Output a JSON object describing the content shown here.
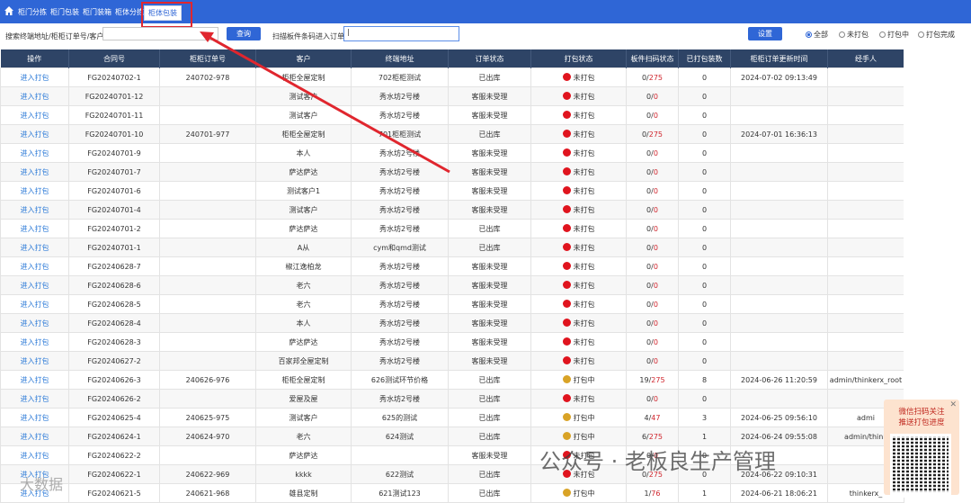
{
  "nav": {
    "tabs": [
      "柜门分拣",
      "柜门包装",
      "柜门装箱",
      "柜体分拣",
      "柜体包装"
    ],
    "active_index": 4
  },
  "search": {
    "label": "搜索终端地址/柜柜订单号/客户",
    "value": "",
    "button": "查询",
    "scan_label": "扫描板件条码进入订单",
    "scan_value": "|",
    "settings_button": "设置"
  },
  "filters": [
    {
      "label": "全部",
      "checked": true
    },
    {
      "label": "未打包",
      "checked": false
    },
    {
      "label": "打包中",
      "checked": false
    },
    {
      "label": "打包完成",
      "checked": false
    }
  ],
  "table": {
    "headers": [
      "操作",
      "合同号",
      "柜柜订单号",
      "客户",
      "终端地址",
      "订单状态",
      "打包状态",
      "板件扫码状态",
      "已打包装数",
      "柜柜订单更新时间",
      "经手人"
    ],
    "action_label": "进入打包",
    "rows": [
      {
        "contract": "FG20240702-1",
        "order_no": "240702-978",
        "customer": "柜柜全屋定制",
        "address": "702柜柜测试",
        "order_status": "已出库",
        "pack_status": "未打包",
        "pack_color": "red",
        "scanned": "0",
        "total": "275",
        "packed": "0",
        "updated": "2024-07-02 09:13:49",
        "handler": ""
      },
      {
        "contract": "FG20240701-12",
        "order_no": "",
        "customer": "测试客户",
        "address": "秀水坊2号楼",
        "order_status": "客服未受理",
        "pack_status": "未打包",
        "pack_color": "red",
        "scanned": "0",
        "total": "0",
        "packed": "0",
        "updated": "",
        "handler": ""
      },
      {
        "contract": "FG20240701-11",
        "order_no": "",
        "customer": "测试客户",
        "address": "秀水坊2号楼",
        "order_status": "客服未受理",
        "pack_status": "未打包",
        "pack_color": "red",
        "scanned": "0",
        "total": "0",
        "packed": "0",
        "updated": "",
        "handler": ""
      },
      {
        "contract": "FG20240701-10",
        "order_no": "240701-977",
        "customer": "柜柜全屋定制",
        "address": "701柜柜测试",
        "order_status": "已出库",
        "pack_status": "未打包",
        "pack_color": "red",
        "scanned": "0",
        "total": "275",
        "packed": "0",
        "updated": "2024-07-01 16:36:13",
        "handler": ""
      },
      {
        "contract": "FG20240701-9",
        "order_no": "",
        "customer": "本人",
        "address": "秀水坊2号楼",
        "order_status": "客服未受理",
        "pack_status": "未打包",
        "pack_color": "red",
        "scanned": "0",
        "total": "0",
        "packed": "0",
        "updated": "",
        "handler": ""
      },
      {
        "contract": "FG20240701-7",
        "order_no": "",
        "customer": "萨达萨达",
        "address": "秀水坊2号楼",
        "order_status": "客服未受理",
        "pack_status": "未打包",
        "pack_color": "red",
        "scanned": "0",
        "total": "0",
        "packed": "0",
        "updated": "",
        "handler": ""
      },
      {
        "contract": "FG20240701-6",
        "order_no": "",
        "customer": "测试客户1",
        "address": "秀水坊2号楼",
        "order_status": "客服未受理",
        "pack_status": "未打包",
        "pack_color": "red",
        "scanned": "0",
        "total": "0",
        "packed": "0",
        "updated": "",
        "handler": ""
      },
      {
        "contract": "FG20240701-4",
        "order_no": "",
        "customer": "测试客户",
        "address": "秀水坊2号楼",
        "order_status": "客服未受理",
        "pack_status": "未打包",
        "pack_color": "red",
        "scanned": "0",
        "total": "0",
        "packed": "0",
        "updated": "",
        "handler": ""
      },
      {
        "contract": "FG20240701-2",
        "order_no": "",
        "customer": "萨达萨达",
        "address": "秀水坊2号楼",
        "order_status": "已出库",
        "pack_status": "未打包",
        "pack_color": "red",
        "scanned": "0",
        "total": "0",
        "packed": "0",
        "updated": "",
        "handler": ""
      },
      {
        "contract": "FG20240701-1",
        "order_no": "",
        "customer": "A从",
        "address": "cym和qmd测试",
        "order_status": "已出库",
        "pack_status": "未打包",
        "pack_color": "red",
        "scanned": "0",
        "total": "0",
        "packed": "0",
        "updated": "",
        "handler": ""
      },
      {
        "contract": "FG20240628-7",
        "order_no": "",
        "customer": "椒江逸柏龙",
        "address": "秀水坊2号楼",
        "order_status": "客服未受理",
        "pack_status": "未打包",
        "pack_color": "red",
        "scanned": "0",
        "total": "0",
        "packed": "0",
        "updated": "",
        "handler": ""
      },
      {
        "contract": "FG20240628-6",
        "order_no": "",
        "customer": "老六",
        "address": "秀水坊2号楼",
        "order_status": "客服未受理",
        "pack_status": "未打包",
        "pack_color": "red",
        "scanned": "0",
        "total": "0",
        "packed": "0",
        "updated": "",
        "handler": ""
      },
      {
        "contract": "FG20240628-5",
        "order_no": "",
        "customer": "老六",
        "address": "秀水坊2号楼",
        "order_status": "客服未受理",
        "pack_status": "未打包",
        "pack_color": "red",
        "scanned": "0",
        "total": "0",
        "packed": "0",
        "updated": "",
        "handler": ""
      },
      {
        "contract": "FG20240628-4",
        "order_no": "",
        "customer": "本人",
        "address": "秀水坊2号楼",
        "order_status": "客服未受理",
        "pack_status": "未打包",
        "pack_color": "red",
        "scanned": "0",
        "total": "0",
        "packed": "0",
        "updated": "",
        "handler": ""
      },
      {
        "contract": "FG20240628-3",
        "order_no": "",
        "customer": "萨达萨达",
        "address": "秀水坊2号楼",
        "order_status": "客服未受理",
        "pack_status": "未打包",
        "pack_color": "red",
        "scanned": "0",
        "total": "0",
        "packed": "0",
        "updated": "",
        "handler": ""
      },
      {
        "contract": "FG20240627-2",
        "order_no": "",
        "customer": "百家邦全屋定制",
        "address": "秀水坊2号楼",
        "order_status": "客服未受理",
        "pack_status": "未打包",
        "pack_color": "red",
        "scanned": "0",
        "total": "0",
        "packed": "0",
        "updated": "",
        "handler": ""
      },
      {
        "contract": "FG20240626-3",
        "order_no": "240626-976",
        "customer": "柜柜全屋定制",
        "address": "626测试环节价格",
        "order_status": "已出库",
        "pack_status": "打包中",
        "pack_color": "yellow",
        "scanned": "19",
        "total": "275",
        "packed": "8",
        "updated": "2024-06-26 11:20:59",
        "handler": "admin/thinkerx_root"
      },
      {
        "contract": "FG20240626-2",
        "order_no": "",
        "customer": "爱屋及屋",
        "address": "秀水坊2号楼",
        "order_status": "已出库",
        "pack_status": "未打包",
        "pack_color": "red",
        "scanned": "0",
        "total": "0",
        "packed": "0",
        "updated": "",
        "handler": ""
      },
      {
        "contract": "FG20240625-4",
        "order_no": "240625-975",
        "customer": "测试客户",
        "address": "625的测试",
        "order_status": "已出库",
        "pack_status": "打包中",
        "pack_color": "yellow",
        "scanned": "4",
        "total": "47",
        "packed": "3",
        "updated": "2024-06-25 09:56:10",
        "handler": "admi"
      },
      {
        "contract": "FG20240624-1",
        "order_no": "240624-970",
        "customer": "老六",
        "address": "624测试",
        "order_status": "已出库",
        "pack_status": "打包中",
        "pack_color": "yellow",
        "scanned": "6",
        "total": "275",
        "packed": "1",
        "updated": "2024-06-24 09:55:08",
        "handler": "admin/think"
      },
      {
        "contract": "FG20240622-2",
        "order_no": "",
        "customer": "萨达萨达",
        "address": "",
        "order_status": "客服未受理",
        "pack_status": "未打包",
        "pack_color": "red",
        "scanned": "0",
        "total": "0",
        "packed": "0",
        "updated": "",
        "handler": ""
      },
      {
        "contract": "FG20240622-1",
        "order_no": "240622-969",
        "customer": "kkkk",
        "address": "622测试",
        "order_status": "已出库",
        "pack_status": "未打包",
        "pack_color": "red",
        "scanned": "0",
        "total": "275",
        "packed": "0",
        "updated": "2024-06-22 09:10:31",
        "handler": ""
      },
      {
        "contract": "FG20240621-5",
        "order_no": "240621-968",
        "customer": "雄县定制",
        "address": "621测试123",
        "order_status": "已出库",
        "pack_status": "打包中",
        "pack_color": "yellow",
        "scanned": "1",
        "total": "76",
        "packed": "1",
        "updated": "2024-06-21 18:06:21",
        "handler": "thinkerx_"
      }
    ]
  },
  "popup": {
    "line1": "微信扫码关注",
    "line2": "推送打包进度",
    "close": "✕"
  },
  "watermark": {
    "text": "公众号 · 老板良生产管理",
    "corner": "大数据"
  },
  "colors": {
    "nav": "#2f66d6",
    "header": "#2e4466",
    "link": "#2f7cd8",
    "status_red": "#e0141e",
    "status_yellow": "#d9a326",
    "highlight": "#e0262e"
  },
  "icons": {
    "home": "home-icon",
    "close": "close-icon",
    "qr": "qr-code-icon"
  }
}
